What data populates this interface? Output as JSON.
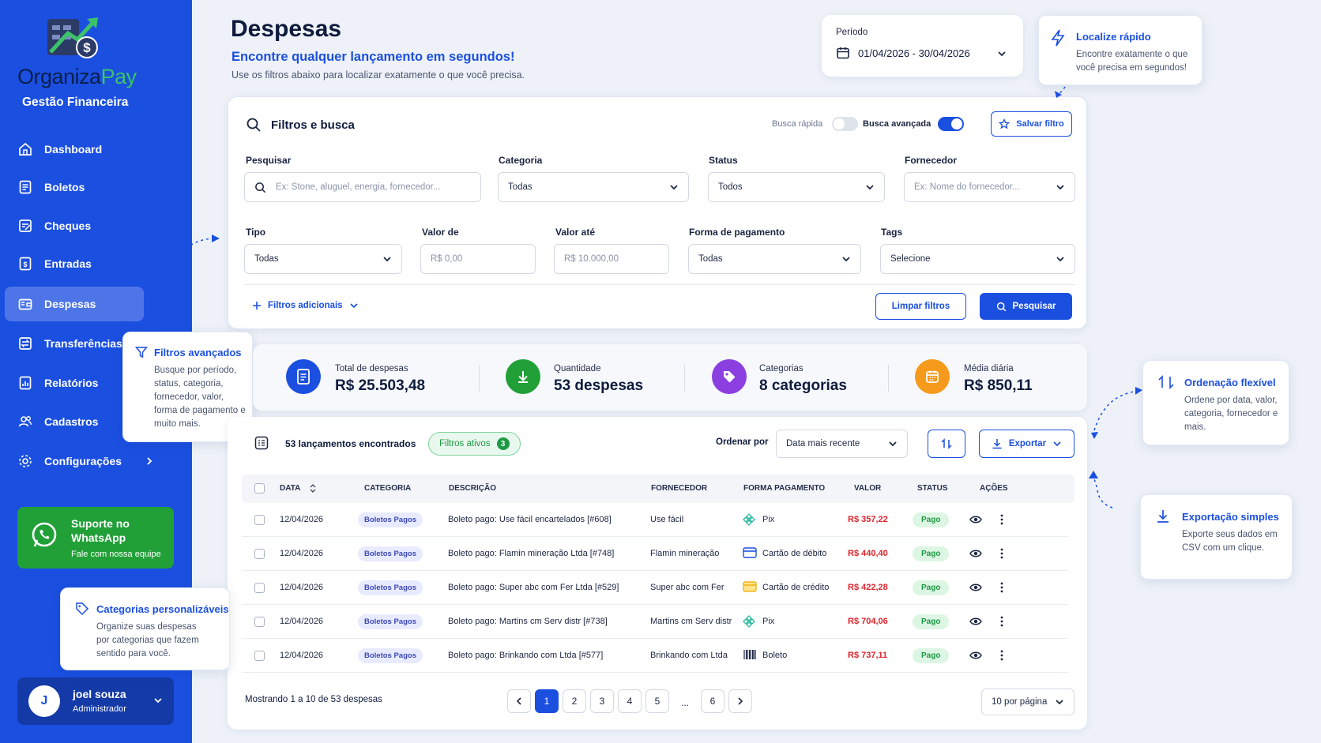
{
  "brand": {
    "name_a": "Organiza",
    "name_b": "Pay",
    "subtitle": "Gestão Financeira"
  },
  "sidebar": {
    "items": [
      {
        "label": "Dashboard",
        "icon": "home-icon"
      },
      {
        "label": "Boletos",
        "icon": "receipt-icon"
      },
      {
        "label": "Cheques",
        "icon": "check-doc-icon"
      },
      {
        "label": "Entradas",
        "icon": "income-icon"
      },
      {
        "label": "Despesas",
        "icon": "wallet-icon",
        "active": true
      },
      {
        "label": "Transferências",
        "icon": "transfer-icon"
      },
      {
        "label": "Relatórios",
        "icon": "report-icon"
      },
      {
        "label": "Cadastros",
        "icon": "users-icon"
      },
      {
        "label": "Configurações",
        "icon": "gear-icon"
      }
    ],
    "whatsapp": {
      "title": "Suporte no WhatsApp",
      "subtitle": "Fale com nossa equipe"
    },
    "user": {
      "initial": "J",
      "name": "joel souza",
      "role": "Administrador"
    }
  },
  "header": {
    "title": "Despesas",
    "subtitle": "Encontre qualquer lançamento em segundos!",
    "description": "Use os filtros abaixo para localizar exatamente o que você precisa.",
    "period_label": "Período",
    "period_value": "01/04/2026 - 30/04/2026"
  },
  "tips": {
    "quick": {
      "title": "Localize rápido",
      "text": "Encontre exatamente o que você precisa em segundos!"
    },
    "advanced": {
      "title": "Filtros avançados",
      "text": "Busque por período, status, categoria, fornecedor, valor, forma de pagamento e muito mais."
    },
    "sort": {
      "title": "Ordenação flexível",
      "text": "Ordene por data, valor, categoria, fornecedor e mais."
    },
    "export": {
      "title": "Exportação simples",
      "text": "Exporte seus dados em CSV com um clique."
    },
    "categories": {
      "title": "Categorias personalizáveis",
      "text": "Organize suas despesas por categorias que fazem sentido para você."
    }
  },
  "filters": {
    "title": "Filtros e busca",
    "quick_search": "Busca rápida",
    "advanced_search": "Busca avançada",
    "save_filter": "Salvar filtro",
    "search_label": "Pesquisar",
    "search_placeholder": "Ex: Stone, aluguel, energia, fornecedor...",
    "category_label": "Categoria",
    "category_value": "Todas",
    "status_label": "Status",
    "status_value": "Todos",
    "supplier_label": "Fornecedor",
    "supplier_placeholder": "Ex: Nome do fornecedor...",
    "type_label": "Tipo",
    "type_value": "Todas",
    "value_from_label": "Valor de",
    "value_from_placeholder": "R$ 0,00",
    "value_to_label": "Valor até",
    "value_to_placeholder": "R$ 10.000,00",
    "payment_label": "Forma de pagamento",
    "payment_value": "Todas",
    "tags_label": "Tags",
    "tags_value": "Selecione",
    "additional": "Filtros adicionais",
    "clear": "Limpar filtros",
    "search_button": "Pesquisar"
  },
  "stats": [
    {
      "label": "Total de despesas",
      "value": "R$ 25.503,48",
      "color": "#1b4fe0",
      "icon": "document-icon"
    },
    {
      "label": "Quantidade",
      "value": "53 despesas",
      "color": "#21a038",
      "icon": "download-arrow-icon"
    },
    {
      "label": "Categorias",
      "value": "8 categorias",
      "color": "#8b3fe0",
      "icon": "tag-icon"
    },
    {
      "label": "Média diária",
      "value": "R$ 850,11",
      "color": "#f59a1b",
      "icon": "calendar-icon"
    }
  ],
  "results": {
    "count": "53 lançamentos encontrados",
    "active_filters": "Filtros ativos",
    "active_count": "3",
    "sort_label": "Ordenar por",
    "sort_value": "Data mais recente",
    "export": "Exportar",
    "columns": [
      "DATA",
      "CATEGORIA",
      "DESCRIÇÃO",
      "FORNECEDOR",
      "FORMA PAGAMENTO",
      "VALOR",
      "STATUS",
      "AÇÕES"
    ],
    "rows": [
      {
        "date": "12/04/2026",
        "category": "Boletos Pagos",
        "description": "Boleto pago: Use fácil encartelados [#608]",
        "supplier": "Use fácil",
        "payment": "Pix",
        "payment_icon": "pix-icon",
        "value": "R$ 357,22",
        "status": "Pago"
      },
      {
        "date": "12/04/2026",
        "category": "Boletos Pagos",
        "description": "Boleto pago: Flamin mineração Ltda [#748]",
        "supplier": "Flamin mineração",
        "payment": "Cartão de débito",
        "payment_icon": "debit-card-icon",
        "value": "R$ 440,40",
        "status": "Pago"
      },
      {
        "date": "12/04/2026",
        "category": "Boletos Pagos",
        "description": "Boleto pago: Super abc com Fer Ltda [#529]",
        "supplier": "Super abc com Fer",
        "payment": "Cartão de crédito",
        "payment_icon": "credit-card-icon",
        "value": "R$ 422,28",
        "status": "Pago"
      },
      {
        "date": "12/04/2026",
        "category": "Boletos Pagos",
        "description": "Boleto pago: Martins cm Serv distr [#738]",
        "supplier": "Martins cm Serv distr",
        "payment": "Pix",
        "payment_icon": "pix-icon",
        "value": "R$ 704,06",
        "status": "Pago"
      },
      {
        "date": "12/04/2026",
        "category": "Boletos Pagos",
        "description": "Boleto pago: Brinkando com Ltda [#577]",
        "supplier": "Brinkando com Ltda",
        "payment": "Boleto",
        "payment_icon": "barcode-icon",
        "value": "R$ 737,11",
        "status": "Pago"
      }
    ],
    "showing": "Mostrando 1 a 10 de 53 despesas",
    "pages": [
      "1",
      "2",
      "3",
      "4",
      "5",
      "...",
      "6"
    ],
    "per_page": "10 por página"
  }
}
